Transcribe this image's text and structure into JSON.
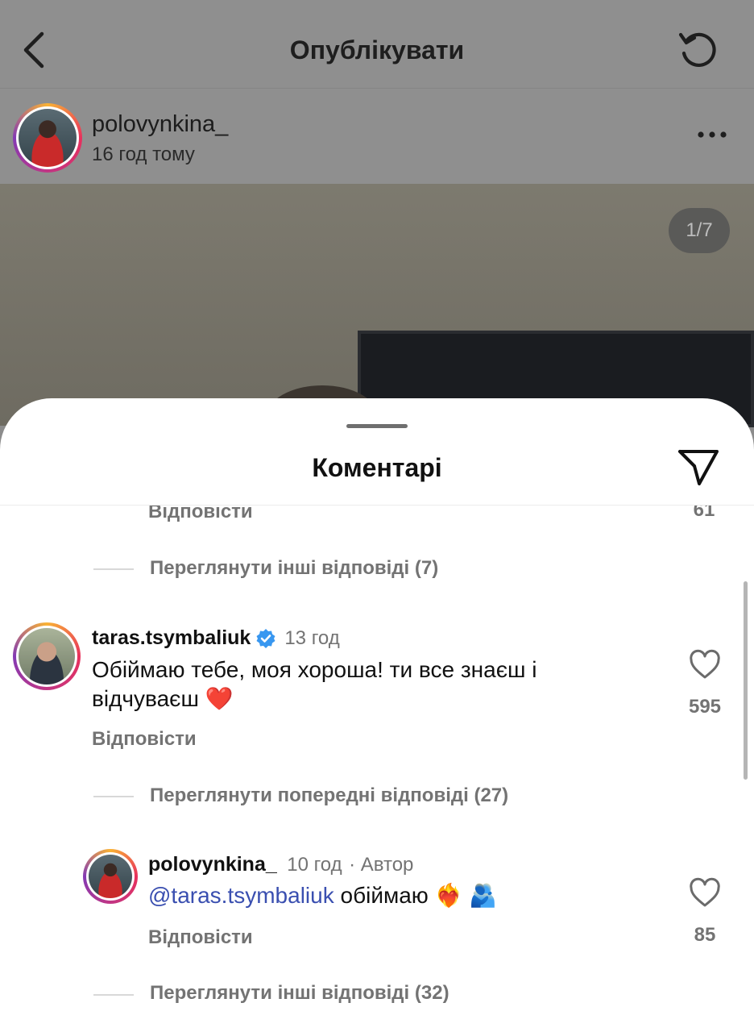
{
  "topbar": {
    "title": "Опублікувати"
  },
  "post": {
    "author": "polovynkina_",
    "time": "16 год тому",
    "media_counter": "1/7"
  },
  "comments_sheet": {
    "title": "Коментарі",
    "partial_row": {
      "reply_label": "Відповісти",
      "like_count": "61"
    },
    "view_more_1": "Переглянути інші відповіді (7)",
    "comment": {
      "username": "taras.tsymbaliuk",
      "verified": true,
      "time": "13 год",
      "text_line1": "Обіймаю тебе, моя хороша! ти все знаєш і",
      "text_line2": "відчуваєш ❤️",
      "reply_label": "Відповісти",
      "like_count": "595"
    },
    "view_previous": "Переглянути попередні відповіді (27)",
    "reply": {
      "username": "polovynkina_",
      "time": "10 год",
      "author_badge": "· Автор",
      "mention": "@taras.tsymbaliuk",
      "text": " обіймаю ❤️‍🔥 🫂",
      "reply_label": "Відповісти",
      "like_count": "85"
    },
    "view_more_2": "Переглянути інші відповіді (32)"
  },
  "colors": {
    "ring_start": "#f9b234",
    "ring_mid": "#e8305c",
    "ring_end": "#833ab4",
    "verified": "#3897f0",
    "mention": "#3a4fb0"
  }
}
